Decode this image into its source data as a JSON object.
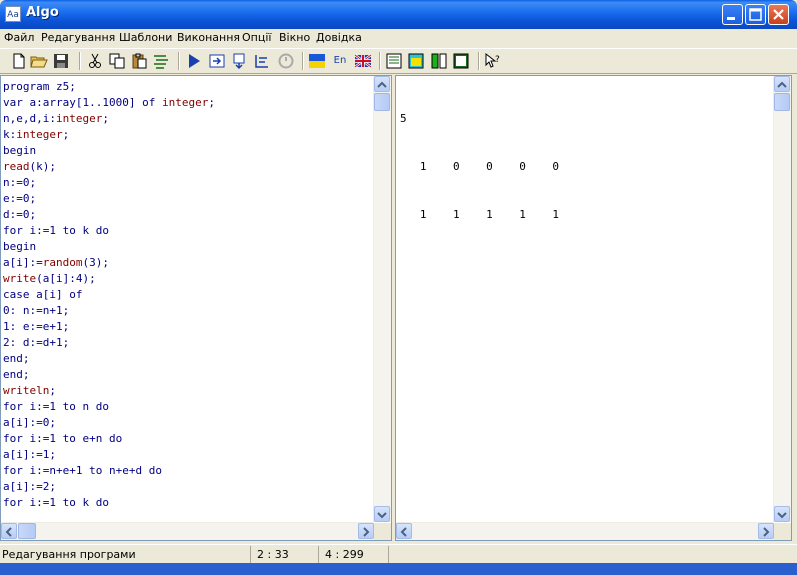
{
  "window": {
    "title": "Algo"
  },
  "menu": [
    "Файл",
    "Редагування",
    "Шаблони",
    "Виконання",
    "Опції",
    "Вікно",
    "Довідка"
  ],
  "toolbar": {
    "lang_en_label": "En"
  },
  "editor": {
    "lines": [
      [
        {
          "t": "program z5;",
          "c": "kw"
        }
      ],
      [
        {
          "t": "var a:array[1..1000] of ",
          "c": "kw"
        },
        {
          "t": "integer",
          "c": "fn"
        },
        {
          "t": ";",
          "c": "kw"
        }
      ],
      [
        {
          "t": "n,e,d,i:",
          "c": "kw"
        },
        {
          "t": "integer",
          "c": "fn"
        },
        {
          "t": ";",
          "c": "kw"
        }
      ],
      [
        {
          "t": "k:",
          "c": "kw"
        },
        {
          "t": "integer",
          "c": "fn"
        },
        {
          "t": ";",
          "c": "kw"
        }
      ],
      [
        {
          "t": "begin",
          "c": "kw"
        }
      ],
      [
        {
          "t": "read",
          "c": "fn"
        },
        {
          "t": "(k);",
          "c": "kw"
        }
      ],
      [
        {
          "t": "n:=0;",
          "c": "kw"
        }
      ],
      [
        {
          "t": "e:=0;",
          "c": "kw"
        }
      ],
      [
        {
          "t": "d:=0;",
          "c": "kw"
        }
      ],
      [
        {
          "t": "for i:=1 to k do",
          "c": "kw"
        }
      ],
      [
        {
          "t": "begin",
          "c": "kw"
        }
      ],
      [
        {
          "t": "a[i]:=",
          "c": "kw"
        },
        {
          "t": "random",
          "c": "fn"
        },
        {
          "t": "(3);",
          "c": "kw"
        }
      ],
      [
        {
          "t": "write",
          "c": "fn"
        },
        {
          "t": "(a[i]:4);",
          "c": "kw"
        }
      ],
      [
        {
          "t": "case a[i] of",
          "c": "kw"
        }
      ],
      [
        {
          "t": "0: n:=n+1;",
          "c": "kw"
        }
      ],
      [
        {
          "t": "1: e:=e+1;",
          "c": "kw"
        }
      ],
      [
        {
          "t": "2: d:=d+1;",
          "c": "kw"
        }
      ],
      [
        {
          "t": "end;",
          "c": "kw"
        }
      ],
      [
        {
          "t": "end;",
          "c": "kw"
        }
      ],
      [
        {
          "t": "writeln",
          "c": "fn"
        },
        {
          "t": ";",
          "c": "kw"
        }
      ],
      [
        {
          "t": "for i:=1 to n do",
          "c": "kw"
        }
      ],
      [
        {
          "t": "a[i]:=0;",
          "c": "kw"
        }
      ],
      [
        {
          "t": "for i:=1 to e+n do",
          "c": "kw"
        }
      ],
      [
        {
          "t": "a[i]:=1;",
          "c": "kw"
        }
      ],
      [
        {
          "t": "for i:=n+e+1 to n+e+d do",
          "c": "kw"
        }
      ],
      [
        {
          "t": "a[i]:=2;",
          "c": "kw"
        }
      ],
      [
        {
          "t": "for i:=1 to k do",
          "c": "kw"
        }
      ]
    ]
  },
  "output": {
    "lines": [
      "5",
      "   1    0    0    0    0",
      "   1    1    1    1    1"
    ]
  },
  "status": {
    "mode": "Редагування програми",
    "cursor": "2 : 33",
    "size": "4 : 299"
  },
  "colors": {
    "keyword": "#000080",
    "function": "#800000",
    "title_bar": "#0b55d8"
  }
}
